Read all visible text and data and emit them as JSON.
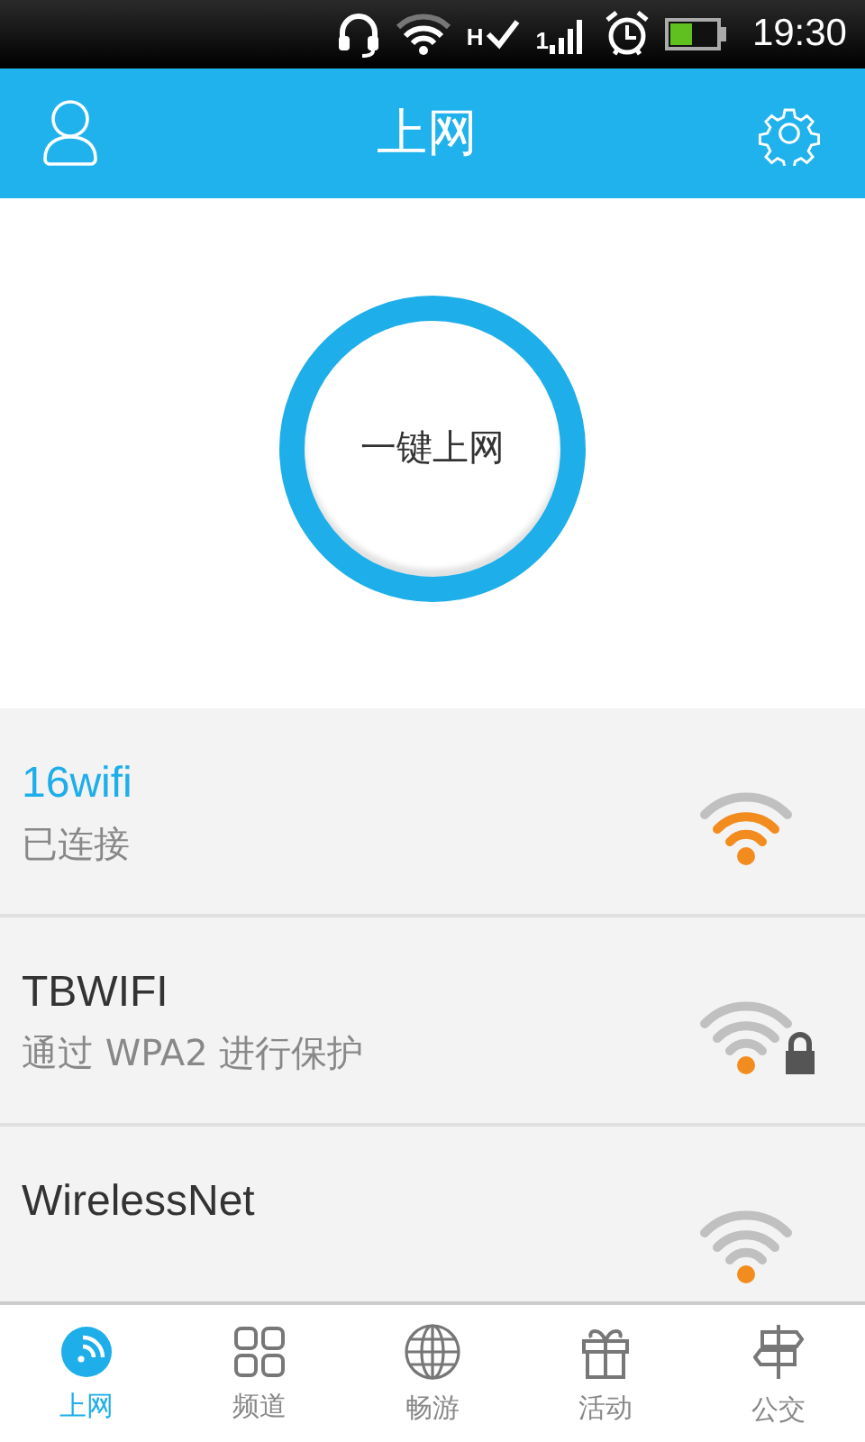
{
  "status_bar": {
    "time": "19:30",
    "network_type": "H",
    "signal_label": "1"
  },
  "header": {
    "title": "上网"
  },
  "connect_button": {
    "label": "一键上网"
  },
  "networks": [
    {
      "name": "16wifi",
      "status": "已连接",
      "connected": true,
      "locked": false
    },
    {
      "name": "TBWIFI",
      "status": "通过 WPA2 进行保护",
      "connected": false,
      "locked": true
    },
    {
      "name": "WirelessNet",
      "connected": false,
      "locked": false
    }
  ],
  "tabs": [
    {
      "label": "上网",
      "kind": "wifi",
      "selected": true
    },
    {
      "label": "频道",
      "kind": "grid",
      "selected": false
    },
    {
      "label": "畅游",
      "kind": "globe",
      "selected": false
    },
    {
      "label": "活动",
      "kind": "gift",
      "selected": false
    },
    {
      "label": "公交",
      "kind": "sign",
      "selected": false
    }
  ]
}
